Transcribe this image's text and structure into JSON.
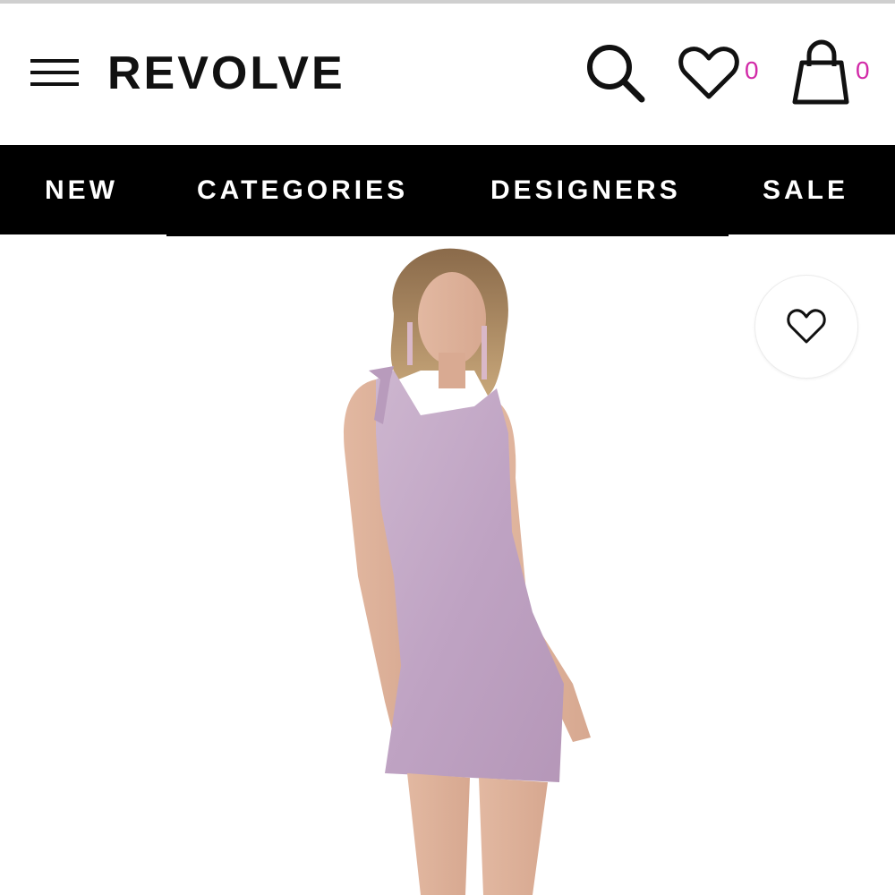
{
  "header": {
    "logo_text": "REVOLVE",
    "menu_icon": "hamburger-menu-icon",
    "search_icon": "search-icon",
    "wishlist_icon": "heart-icon",
    "wishlist_count": "0",
    "bag_icon": "shopping-bag-icon",
    "bag_count": "0",
    "count_color": "#d22aa8"
  },
  "nav": {
    "items": [
      {
        "label": "NEW"
      },
      {
        "label": "CATEGORIES"
      },
      {
        "label": "DESIGNERS"
      },
      {
        "label": "SALE"
      }
    ],
    "background": "#000000",
    "text_color": "#ffffff"
  },
  "product": {
    "image_alt": "Model wearing lavender one-shoulder mini dress",
    "dress_color": "#c3a9c7",
    "favorite_icon": "heart-outline-icon"
  }
}
